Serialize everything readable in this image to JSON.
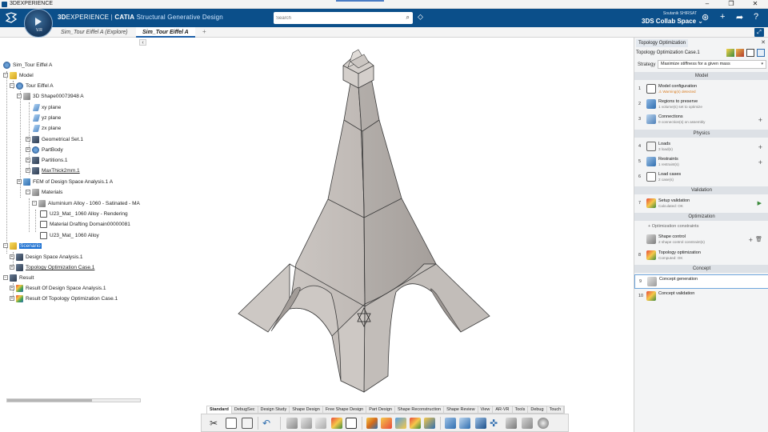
{
  "window": {
    "title": "3DEXPERIENCE",
    "min": "–",
    "max": "❐",
    "close": "✕"
  },
  "header": {
    "brand_bold": "3D",
    "brand_rest": "EXPERIENCE",
    "brand_sep": " | ",
    "brand_catia": "CATIA",
    "app_name": " Structural Generative Design",
    "compass_version": "V.R",
    "search_placeholder": "Search",
    "user_name": "Soutanik SHIRSAT",
    "collab_space": "3DS Collab Space",
    "collab_chevron": "⌄"
  },
  "tabs": [
    {
      "label": "Sim_Tour Eiffel A (Explore)",
      "active": false
    },
    {
      "label": "Sim_Tour Eiffel A",
      "active": true
    }
  ],
  "tab_add": "+",
  "tree": {
    "collapse": "‹",
    "rows": [
      {
        "label": "Sim_Tour Eiffel A",
        "icon": "gear"
      },
      {
        "label": "Model",
        "icon": "yellow"
      },
      {
        "label": "Tour Eiffel A",
        "icon": "gear"
      },
      {
        "label": "3D Shape00073948 A",
        "icon": "grey"
      },
      {
        "label": "xy plane",
        "icon": "plane"
      },
      {
        "label": "yz plane",
        "icon": "plane"
      },
      {
        "label": "zx plane",
        "icon": "plane"
      },
      {
        "label": "Geometrical Set.1",
        "icon": "dark"
      },
      {
        "label": "PartBody",
        "icon": "gear"
      },
      {
        "label": "Partitions.1",
        "icon": "dark"
      },
      {
        "label": "MaxThick2mm.1",
        "icon": "dark"
      },
      {
        "label": "FEM of Design Space Analysis.1 A",
        "icon": "blue"
      },
      {
        "label": "Materials",
        "icon": "grey"
      },
      {
        "label": "Aluminium Alloy - 1060 - Satinated - MA",
        "icon": "grey"
      },
      {
        "label": "U23_Mat_ 1060 Alloy - Rendering",
        "icon": "grid"
      },
      {
        "label": "Material Drafting Domain00000081",
        "icon": "grid"
      },
      {
        "label": "U23_Mat_ 1060 Alloy",
        "icon": "grid"
      },
      {
        "label": "Scenario",
        "icon": "yellow"
      },
      {
        "label": "Design Space Analysis.1",
        "icon": "dark"
      },
      {
        "label": "Topology Optimization Case.1",
        "icon": "dark"
      },
      {
        "label": "Result",
        "icon": "dark"
      },
      {
        "label": "Result Of Design Space Analysis.1",
        "icon": "multi"
      },
      {
        "label": "Result Of Topology Optimization Case.1",
        "icon": "multi"
      }
    ]
  },
  "panel": {
    "title": "Topology Optimization",
    "close": "✕",
    "case": "Topology Optimization Case.1",
    "strategy_label": "Strategy",
    "strategy_value": "Maximize stiffness for a given mass",
    "sections": {
      "model": "Model",
      "physics": "Physics",
      "validation": "Validation",
      "optimization": "Optimization",
      "concept": "Concept"
    },
    "steps": [
      {
        "num": "1",
        "name": "Model configuration",
        "sub": "⚠ Warning(s) detected"
      },
      {
        "num": "2",
        "name": "Regions to preserve",
        "sub": "1 volume(s) set to optimize"
      },
      {
        "num": "3",
        "name": "Connections",
        "sub": "0 connection(s) on assembly"
      },
      {
        "num": "4",
        "name": "Loads",
        "sub": "3 load(s)"
      },
      {
        "num": "5",
        "name": "Restraints",
        "sub": "1 restraint(s)"
      },
      {
        "num": "6",
        "name": "Load cases",
        "sub": "2 case(s)"
      },
      {
        "num": "7",
        "name": "Setup validation",
        "sub": "Calculated: OK"
      },
      {
        "num": "",
        "name": "Shape control",
        "sub": "2 shape control constraint(s)"
      },
      {
        "num": "8",
        "name": "Topology optimization",
        "sub": "Computed: OK"
      },
      {
        "num": "9",
        "name": "Concept generation",
        "sub": ""
      },
      {
        "num": "10",
        "name": "Concept validation",
        "sub": ""
      }
    ],
    "opt_constraints": "Optimization constraints"
  },
  "toolbar": {
    "tabs": [
      "Standard",
      "DebugSec",
      "Design Study",
      "Shape Design",
      "Free Shape Design",
      "Part Design",
      "Shape Reconstruction",
      "Shape Review",
      "View",
      "AR-VR",
      "Tools",
      "Debug",
      "Touch"
    ],
    "active_tab": "Standard"
  },
  "colors": {
    "topbar": "#0b4f8a",
    "model_fill": "#c7c2be",
    "model_edge": "#3a3a3a",
    "selection": "#1a6fd1"
  }
}
